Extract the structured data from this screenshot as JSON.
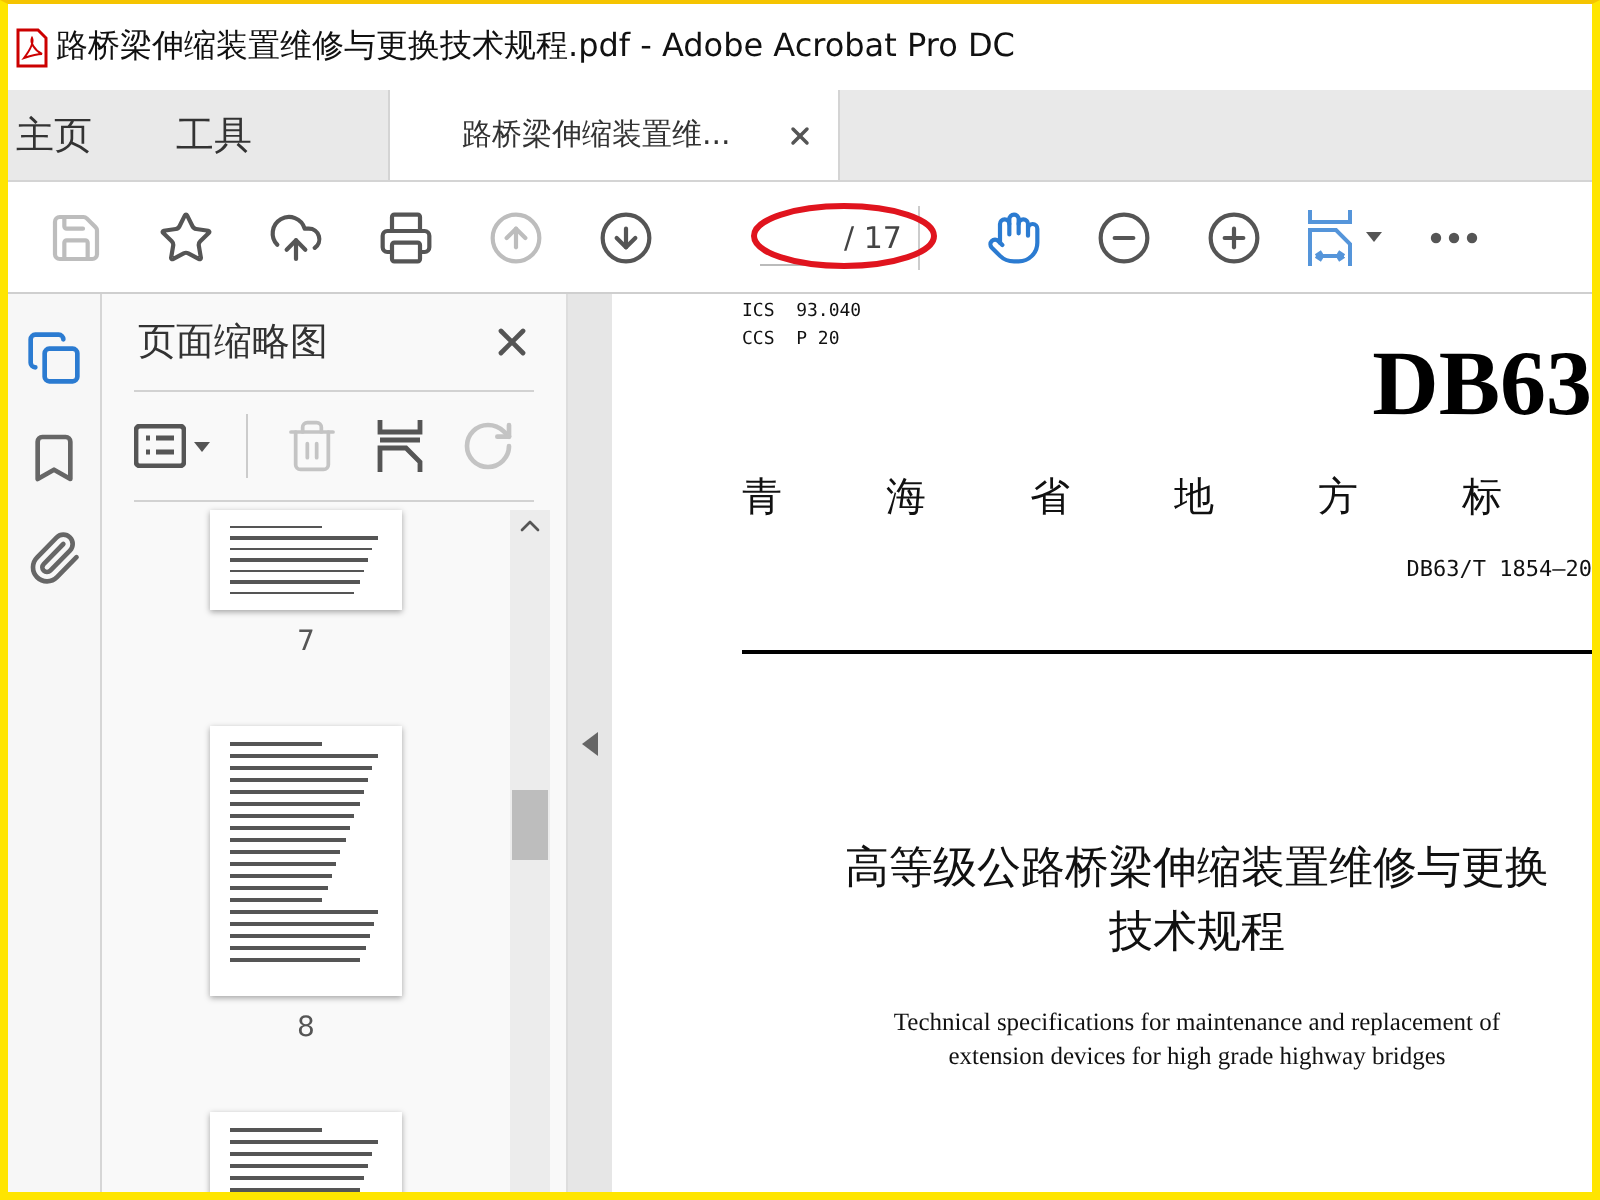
{
  "window": {
    "title": "路桥梁伸缩装置维修与更换技术规程.pdf - Adobe Acrobat Pro DC"
  },
  "nav_tabs": [
    {
      "label": "主页",
      "selected": false
    },
    {
      "label": "工具",
      "selected": false
    }
  ],
  "document_tab": {
    "label": "路桥梁伸缩装置维...",
    "selected": true
  },
  "toolbar": {
    "left_buttons": [
      {
        "kind": "save",
        "disabled": true
      },
      {
        "kind": "star",
        "disabled": false
      },
      {
        "kind": "upload",
        "disabled": false
      },
      {
        "kind": "print",
        "disabled": false
      },
      {
        "kind": "prev",
        "disabled": true
      },
      {
        "kind": "next",
        "disabled": false
      }
    ],
    "page_total": "/ 17",
    "right_buttons": [
      {
        "kind": "hand",
        "selected": true
      },
      {
        "kind": "zoom-out",
        "selected": false
      },
      {
        "kind": "zoom-in",
        "selected": false
      },
      {
        "kind": "fit",
        "selected": false
      },
      {
        "kind": "more",
        "selected": false
      }
    ]
  },
  "side_rail": [
    {
      "kind": "pages",
      "selected": true
    },
    {
      "kind": "bookmarks",
      "selected": false
    },
    {
      "kind": "attachments",
      "selected": false
    }
  ],
  "thumbnail_panel": {
    "title": "页面缩略图",
    "tools": [
      {
        "kind": "options",
        "disabled": false
      },
      {
        "kind": "delete",
        "disabled": true
      },
      {
        "kind": "insert",
        "disabled": false
      },
      {
        "kind": "rotate",
        "disabled": true
      }
    ],
    "thumbnails": [
      {
        "kind": "top-cut",
        "label": "7"
      },
      {
        "kind": "full",
        "label": "8"
      },
      {
        "kind": "bottom-cut"
      }
    ]
  },
  "document": {
    "ics": "ICS  93.040",
    "ccs": "CCS  P 20",
    "code": "DB63",
    "issuer": [
      "青",
      "海",
      "省",
      "地",
      "方",
      "标"
    ],
    "standard_no": "DB63/T 1854—20",
    "title_lines": [
      "高等级公路桥梁伸缩装置维修与更换",
      "技术规程"
    ],
    "subtitle_lines": [
      "Technical specifications for maintenance and replacement of",
      "extension devices for high grade highway bridges"
    ]
  }
}
